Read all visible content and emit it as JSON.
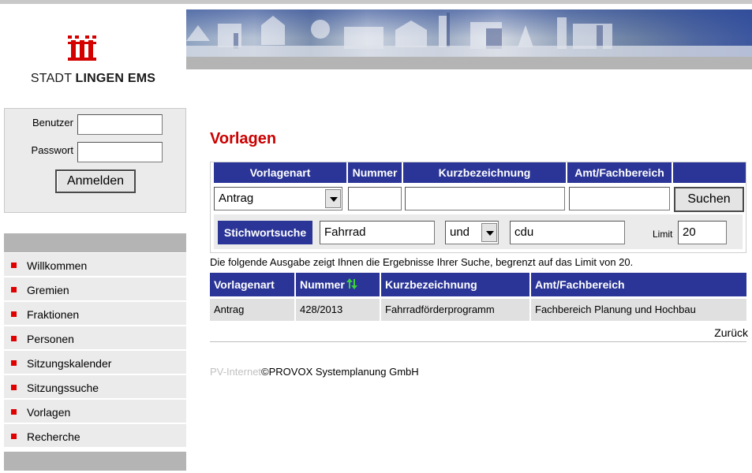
{
  "brand": {
    "city_name_prefix": "STADT",
    "city_name_bold": "LINGEN EMS"
  },
  "login": {
    "user_label": "Benutzer",
    "password_label": "Passwort",
    "user_value": "",
    "password_value": "",
    "submit_label": "Anmelden"
  },
  "nav": {
    "items": [
      {
        "label": "Willkommen"
      },
      {
        "label": "Gremien"
      },
      {
        "label": "Fraktionen"
      },
      {
        "label": "Personen"
      },
      {
        "label": "Sitzungskalender"
      },
      {
        "label": "Sitzungssuche"
      },
      {
        "label": "Vorlagen"
      },
      {
        "label": "Recherche"
      }
    ]
  },
  "page": {
    "title": "Vorlagen"
  },
  "search": {
    "headers": {
      "vorlagenart": "Vorlagenart",
      "nummer": "Nummer",
      "kurzbezeichnung": "Kurzbezeichnung",
      "amt": "Amt/Fachbereich"
    },
    "vorlagenart_value": "Antrag",
    "nummer_value": "",
    "kurzbezeichnung_value": "",
    "amt_value": "",
    "submit_label": "Suchen",
    "stichwort_label": "Stichwortsuche",
    "stichwort1_value": "Fahrrad",
    "operator_value": "und",
    "stichwort2_value": "cdu",
    "limit_label": "Limit",
    "limit_value": "20"
  },
  "info_text": "Die folgende Ausgabe zeigt Ihnen die Ergebnisse Ihrer Suche, begrenzt auf das Limit von 20.",
  "results": {
    "headers": {
      "vorlagenart": "Vorlagenart",
      "nummer": "Nummer",
      "kurzbezeichnung": "Kurzbezeichnung",
      "amt": "Amt/Fachbereich"
    },
    "rows": [
      {
        "vorlagenart": "Antrag",
        "nummer": "428/2013",
        "kurzbezeichnung": "Fahrradförderprogramm",
        "amt": "Fachbereich Planung und Hochbau"
      }
    ]
  },
  "back_link": "Zurück",
  "footer": {
    "product": "PV-Internet",
    "copyright": "©PROVOX Systemplanung GmbH"
  },
  "colors": {
    "accent_blue": "#2b3597",
    "title_red": "#cc0000",
    "nav_bullet": "#e00000",
    "panel_grey": "#ebebeb"
  }
}
